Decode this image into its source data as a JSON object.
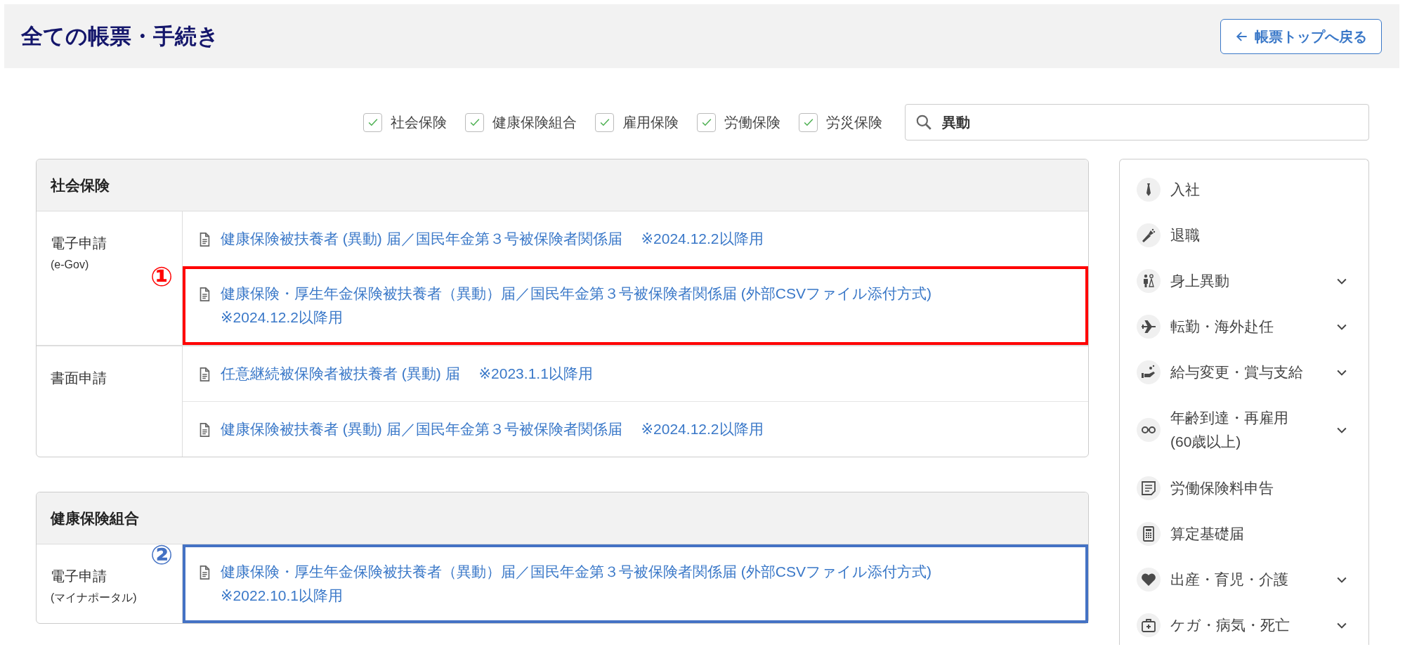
{
  "page": {
    "title": "全ての帳票・手続き",
    "back_button": "帳票トップへ戻る"
  },
  "filters": [
    {
      "label": "社会保険",
      "checked": true
    },
    {
      "label": "健康保険組合",
      "checked": true
    },
    {
      "label": "雇用保険",
      "checked": true
    },
    {
      "label": "労働保険",
      "checked": true
    },
    {
      "label": "労災保険",
      "checked": true
    }
  ],
  "search": {
    "value": "異動"
  },
  "sections": [
    {
      "title": "社会保険",
      "groups": [
        {
          "label": "電子申請",
          "sublabel": "(e-Gov)",
          "links": [
            {
              "text": "健康保険被扶養者 (異動) 届／国民年金第３号被保険者関係届　 ※2024.12.2以降用"
            },
            {
              "text": "健康保険・厚生年金保険被扶養者（異動）届／国民年金第３号被保険者関係届 (外部CSVファイル添付方式)\n※2024.12.2以降用",
              "highlight": {
                "marker": "①",
                "color": "#ff0000"
              }
            }
          ]
        },
        {
          "label": "書面申請",
          "links": [
            {
              "text": "任意継続被保険者被扶養者 (異動) 届　 ※2023.1.1以降用"
            },
            {
              "text": "健康保険被扶養者 (異動) 届／国民年金第３号被保険者関係届　 ※2024.12.2以降用"
            }
          ]
        }
      ]
    },
    {
      "title": "健康保険組合",
      "groups": [
        {
          "label": "電子申請",
          "sublabel": "(マイナポータル)",
          "links": [
            {
              "text": "健康保険・厚生年金保険被扶養者（異動）届／国民年金第３号被保険者関係届 (外部CSVファイル添付方式)\n※2022.10.1以降用",
              "highlight": {
                "marker": "②",
                "color": "#4472c4"
              }
            }
          ]
        }
      ]
    }
  ],
  "sidebar": {
    "items": [
      {
        "label": "入社",
        "expandable": false
      },
      {
        "label": "退職",
        "expandable": false
      },
      {
        "label": "身上異動",
        "expandable": true
      },
      {
        "label": "転勤・海外赴任",
        "expandable": true
      },
      {
        "label": "給与変更・賞与支給",
        "expandable": true
      },
      {
        "label": "年齢到達・再雇用\n(60歳以上)",
        "expandable": true
      },
      {
        "label": "労働保険料申告",
        "expandable": false
      },
      {
        "label": "算定基礎届",
        "expandable": false
      },
      {
        "label": "出産・育児・介護",
        "expandable": true
      },
      {
        "label": "ケガ・病気・死亡",
        "expandable": true
      }
    ]
  }
}
